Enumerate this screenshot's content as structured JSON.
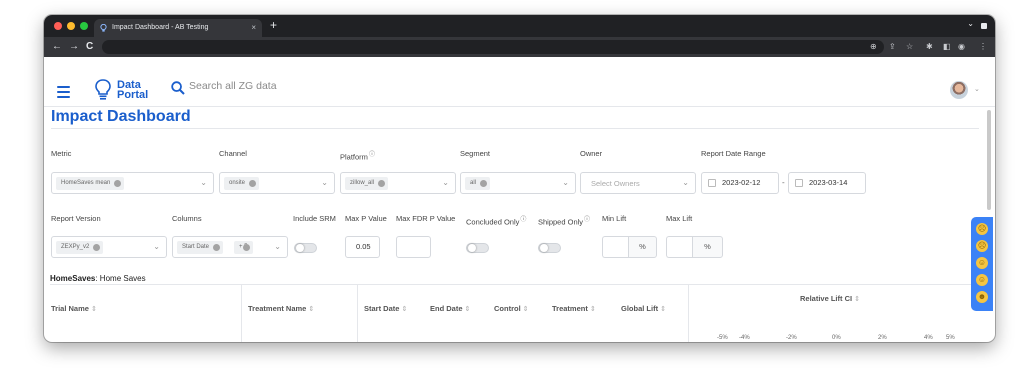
{
  "browser": {
    "tab_title": "Impact Dashboard - AB Testing",
    "tab_close": "×",
    "new_tab": "+",
    "back": "←",
    "forward": "→",
    "reload": "C",
    "tab_list": "⌄"
  },
  "app": {
    "logo_line1": "Data",
    "logo_line2": "Portal",
    "search_placeholder": "Search all ZG data"
  },
  "page": {
    "title": "Impact Dashboard"
  },
  "filters": {
    "metric": {
      "label": "Metric",
      "value": "HomeSaves mean"
    },
    "channel": {
      "label": "Channel",
      "value": "onsite"
    },
    "platform": {
      "label": "Platform",
      "value": "zillow_all"
    },
    "segment": {
      "label": "Segment",
      "value": "all"
    },
    "owner": {
      "label": "Owner",
      "placeholder": "Select Owners"
    },
    "date_range": {
      "label": "Report Date Range",
      "start": "2023-02-12",
      "separator": "-",
      "end": "2023-03-14"
    },
    "report_version": {
      "label": "Report Version",
      "value": "ZEXPy_v2"
    },
    "columns": {
      "label": "Columns",
      "value": "Start Date",
      "more": "+ 5"
    },
    "include_srm": {
      "label": "Include SRM",
      "on": false
    },
    "max_p": {
      "label": "Max P Value",
      "value": "0.05"
    },
    "max_fdr": {
      "label": "Max FDR P Value",
      "value": ""
    },
    "concluded_only": {
      "label": "Concluded Only",
      "on": false
    },
    "shipped_only": {
      "label": "Shipped Only",
      "on": false
    },
    "min_lift": {
      "label": "Min Lift",
      "unit": "%"
    },
    "max_lift": {
      "label": "Max Lift",
      "unit": "%"
    }
  },
  "section": {
    "metric_key": "HomeSaves",
    "metric_name": ": Home Saves"
  },
  "table": {
    "columns": [
      "Trial Name",
      "Treatment Name",
      "Start Date",
      "End Date",
      "Control",
      "Treatment",
      "Global Lift"
    ],
    "lift_header": "Relative Lift CI",
    "sort_icon": "⇕",
    "ticks": [
      "-5%",
      "-4%",
      "-2%",
      "0%",
      "2%",
      "4%",
      "5%"
    ]
  },
  "colors": {
    "brand": "#1a5ecc",
    "feedback": "#3b82f6"
  }
}
